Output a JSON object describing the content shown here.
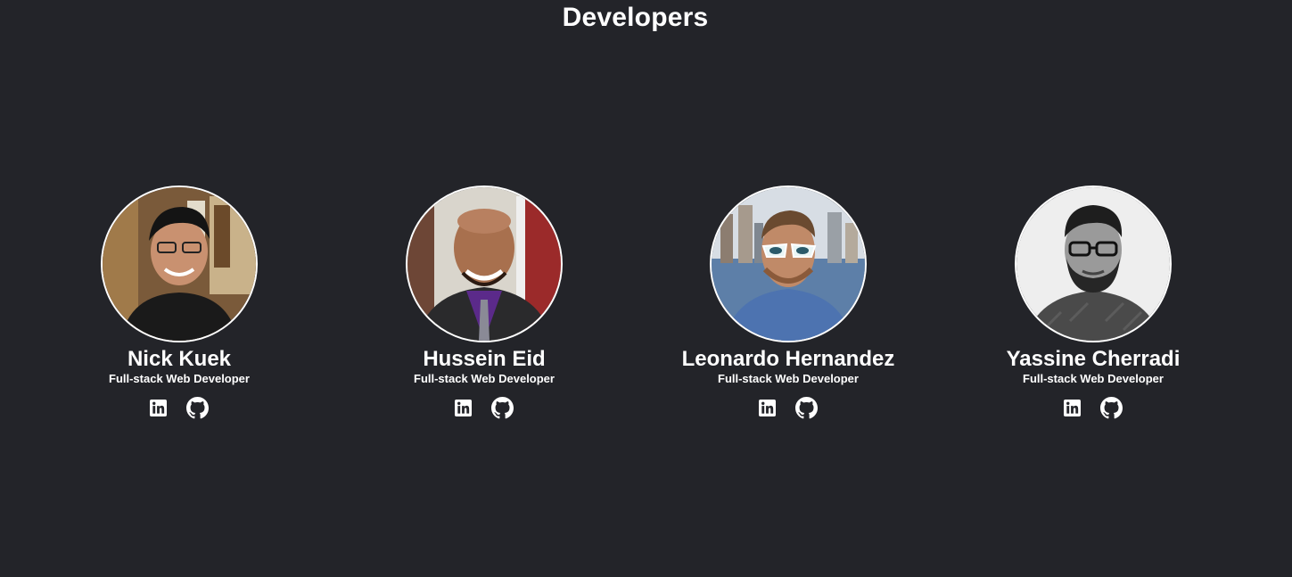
{
  "page": {
    "title": "Developers",
    "background": "#232429"
  },
  "developers": [
    {
      "name": "Nick Kuek",
      "role": "Full-stack Web Developer",
      "links": [
        "linkedin-icon",
        "github-icon"
      ]
    },
    {
      "name": "Hussein Eid",
      "role": "Full-stack Web Developer",
      "links": [
        "linkedin-icon",
        "github-icon"
      ]
    },
    {
      "name": "Leonardo Hernandez",
      "role": "Full-stack Web Developer",
      "links": [
        "linkedin-icon",
        "github-icon"
      ]
    },
    {
      "name": "Yassine Cherradi",
      "role": "Full-stack Web Developer",
      "links": [
        "linkedin-icon",
        "github-icon"
      ]
    }
  ]
}
